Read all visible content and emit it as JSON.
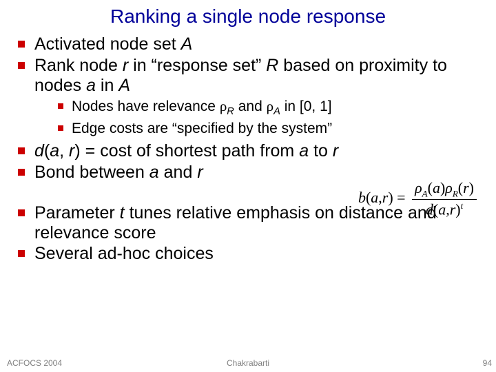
{
  "title": "Ranking a single node response",
  "bullets": {
    "b1_pre": "Activated node set ",
    "b1_ital": "A",
    "b2_pre": "Rank node ",
    "b2_r": "r",
    "b2_mid1": "  in “response set” ",
    "b2_R": "R",
    "b2_mid2": "  based on proximity to nodes ",
    "b2_a": "a",
    "b2_mid3": "  in ",
    "b2_A": "A",
    "s1_pre": "Nodes have relevance ",
    "s1_rhoR_rho": "ρ",
    "s1_rhoR_sub": "R",
    "s1_and": "  and ",
    "s1_rhoA_rho": "ρ",
    "s1_rhoA_sub": "A",
    "s1_tail": "  in [0, 1]",
    "s2": "Edge costs are “specified by the system”",
    "b3_ital": "d",
    "b3_paren": "(",
    "b3_a": "a",
    "b3_comma": ", ",
    "b3_r": "r",
    "b3_cparen": ")",
    "b3_mid": " = cost of shortest path from ",
    "b3_a2": "a",
    "b3_to": "  to ",
    "b3_r2": "r",
    "b4_pre": "Bond between ",
    "b4_a": "a",
    "b4_and": " and ",
    "b4_r": "r",
    "b5_pre": "Parameter ",
    "b5_t": "t",
    "b5_tail": "  tunes relative emphasis on distance and relevance score",
    "b6": "Several ad-hoc choices"
  },
  "formula": {
    "lhs_b": "b",
    "lhs_open": "(",
    "lhs_a": "a",
    "lhs_comma": ",",
    "lhs_r": "r",
    "lhs_close": ")",
    "eq": " = ",
    "num_rho1": "ρ",
    "num_subA": "A",
    "num_open1": "(",
    "num_a": "a",
    "num_close1": ")",
    "num_rho2": "ρ",
    "num_subR": "R",
    "num_open2": "(",
    "num_r": "r",
    "num_close2": ")",
    "den_d": "d",
    "den_open": "(",
    "den_a": "a",
    "den_comma": ",",
    "den_r": "r",
    "den_close": ")",
    "den_supt": "t"
  },
  "footer": {
    "left": "ACFOCS 2004",
    "center": "Chakrabarti",
    "right": "94"
  }
}
